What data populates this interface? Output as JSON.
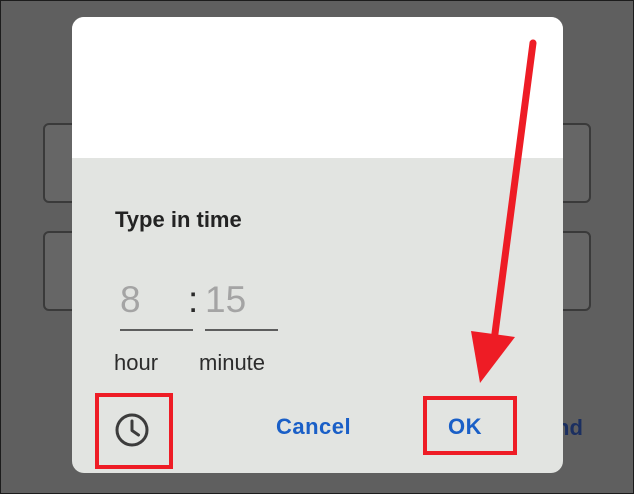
{
  "dialog": {
    "title": "Type in time",
    "hour": {
      "value": "8",
      "label": "hour"
    },
    "separator": ":",
    "minute": {
      "value": "15",
      "label": "minute"
    },
    "cancel_label": "Cancel",
    "ok_label": "OK",
    "mode_toggle_icon": "clock-icon"
  },
  "background": {
    "partial_action_text": "nd"
  },
  "colors": {
    "accent": "#1a5fc7",
    "annotation": "#ee1c25",
    "dialog_body": "#e2e4e1",
    "scrim": "#5f5f5f"
  }
}
